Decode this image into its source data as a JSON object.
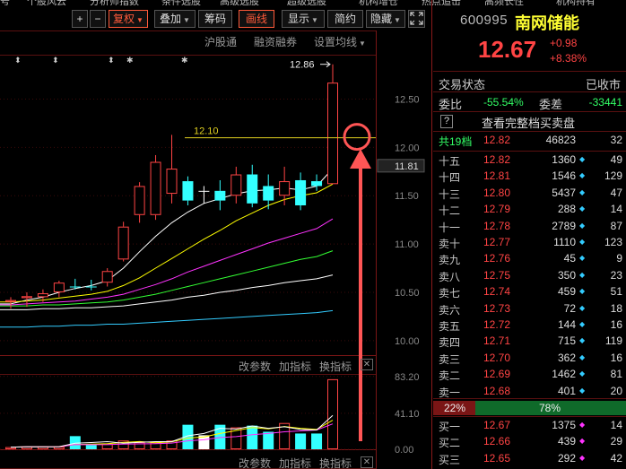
{
  "menu_strip": [
    "号",
    "个股风云",
    "分析师指数",
    "条件选股",
    "高级选股",
    "超级选股",
    "机构增仓",
    "热点追击",
    "高频长性",
    "机构持有"
  ],
  "toolbar": {
    "plus": "+",
    "minus": "−",
    "fq_label": "复权",
    "overlay_label": "叠加",
    "chips_label": "筹码",
    "draw_label": "画线",
    "display_label": "显示",
    "simple_label": "简约",
    "hide_label": "隐藏",
    "expand_icon": "expand-icon"
  },
  "chart_links": {
    "hgt": "沪股通",
    "margin": "融资融券",
    "settings": "设置均线"
  },
  "indicator_bar_1": {
    "params": "改参数",
    "add": "加指标",
    "swap": "换指标",
    "close": "✕"
  },
  "indicator_bar_2": {
    "params": "改参数",
    "add": "加指标",
    "swap": "换指标",
    "close": "✕"
  },
  "annotations": {
    "high_label": "12.86",
    "hline_label": "12.10"
  },
  "chart_data": [
    {
      "type": "candlestick",
      "title": "",
      "y_ticks": [
        "12.50",
        "12.00",
        "11.50",
        "11.00",
        "10.50",
        "10.00"
      ],
      "y_range": [
        9.85,
        12.95
      ],
      "current_price_label": "11.81",
      "candles": [
        {
          "o": 10.4,
          "h": 10.45,
          "l": 10.33,
          "c": 10.42,
          "color": "red"
        },
        {
          "o": 10.44,
          "h": 10.5,
          "l": 10.35,
          "c": 10.46,
          "color": "red"
        },
        {
          "o": 10.45,
          "h": 10.53,
          "l": 10.4,
          "c": 10.49,
          "color": "red"
        },
        {
          "o": 10.5,
          "h": 10.62,
          "l": 10.45,
          "c": 10.6,
          "color": "red"
        },
        {
          "o": 10.56,
          "h": 10.64,
          "l": 10.53,
          "c": 10.56,
          "color": "cyan"
        },
        {
          "o": 10.56,
          "h": 10.63,
          "l": 10.52,
          "c": 10.56,
          "color": "cyan"
        },
        {
          "o": 10.6,
          "h": 10.75,
          "l": 10.56,
          "c": 10.72,
          "color": "red"
        },
        {
          "o": 10.84,
          "h": 11.23,
          "l": 10.82,
          "c": 11.18,
          "color": "red"
        },
        {
          "o": 11.3,
          "h": 11.64,
          "l": 11.22,
          "c": 11.6,
          "color": "red"
        },
        {
          "o": 11.3,
          "h": 11.92,
          "l": 11.25,
          "c": 11.85,
          "color": "red"
        },
        {
          "o": 11.52,
          "h": 12.13,
          "l": 11.42,
          "c": 11.78,
          "color": "red"
        },
        {
          "o": 11.65,
          "h": 11.7,
          "l": 11.4,
          "c": 11.45,
          "color": "cyan"
        },
        {
          "o": 11.55,
          "h": 11.6,
          "l": 11.42,
          "c": 11.55,
          "color": "white"
        },
        {
          "o": 11.55,
          "h": 11.66,
          "l": 11.35,
          "c": 11.45,
          "color": "cyan"
        },
        {
          "o": 11.5,
          "h": 11.8,
          "l": 11.42,
          "c": 11.72,
          "color": "red"
        },
        {
          "o": 11.72,
          "h": 11.82,
          "l": 11.38,
          "c": 11.42,
          "color": "cyan"
        },
        {
          "o": 11.6,
          "h": 11.72,
          "l": 11.36,
          "c": 11.45,
          "color": "cyan"
        },
        {
          "o": 11.5,
          "h": 11.8,
          "l": 11.4,
          "c": 11.65,
          "color": "red"
        },
        {
          "o": 11.66,
          "h": 11.74,
          "l": 11.35,
          "c": 11.4,
          "color": "cyan"
        },
        {
          "o": 11.65,
          "h": 11.72,
          "l": 11.55,
          "c": 11.6,
          "color": "cyan"
        },
        {
          "o": 11.62,
          "h": 12.86,
          "l": 11.62,
          "c": 12.67,
          "color": "red"
        }
      ],
      "ma_lines": [
        {
          "color": "#ffffff",
          "values": [
            10.38,
            10.42,
            10.45,
            10.5,
            10.54,
            10.57,
            10.62,
            10.75,
            10.92,
            11.08,
            11.22,
            11.33,
            11.42,
            11.47,
            11.52,
            11.55,
            11.56,
            11.58,
            11.56,
            11.6,
            11.78
          ]
        },
        {
          "color": "#ffff00",
          "values": [
            10.4,
            10.41,
            10.42,
            10.44,
            10.46,
            10.48,
            10.51,
            10.57,
            10.65,
            10.75,
            10.85,
            10.95,
            11.05,
            11.14,
            11.24,
            11.32,
            11.4,
            11.46,
            11.5,
            11.53,
            11.62
          ]
        },
        {
          "color": "#ff33ff",
          "values": [
            10.37,
            10.38,
            10.39,
            10.4,
            10.41,
            10.43,
            10.45,
            10.48,
            10.53,
            10.58,
            10.64,
            10.71,
            10.77,
            10.83,
            10.89,
            10.95,
            11.01,
            11.06,
            11.11,
            11.16,
            11.26
          ]
        },
        {
          "color": "#33ff33",
          "values": [
            10.36,
            10.36,
            10.37,
            10.37,
            10.38,
            10.39,
            10.4,
            10.42,
            10.45,
            10.48,
            10.52,
            10.56,
            10.6,
            10.64,
            10.68,
            10.72,
            10.76,
            10.8,
            10.84,
            10.87,
            10.93
          ]
        },
        {
          "color": "#ffffff",
          "values": [
            10.32,
            10.32,
            10.33,
            10.33,
            10.34,
            10.34,
            10.35,
            10.36,
            10.38,
            10.4,
            10.42,
            10.45,
            10.47,
            10.5,
            10.52,
            10.55,
            10.57,
            10.6,
            10.62,
            10.64,
            10.68
          ]
        },
        {
          "color": "#33ccff",
          "values": [
            10.14,
            10.14,
            10.15,
            10.15,
            10.16,
            10.16,
            10.17,
            10.17,
            10.18,
            10.19,
            10.2,
            10.21,
            10.22,
            10.23,
            10.24,
            10.25,
            10.26,
            10.27,
            10.28,
            10.29,
            10.31
          ]
        }
      ]
    },
    {
      "type": "bar",
      "title": "",
      "y_ticks": [
        "83.20",
        "41.10",
        "0.00"
      ],
      "y_range": [
        0,
        85
      ],
      "values": [
        2.5,
        3,
        3,
        3,
        15,
        5,
        6,
        10,
        8,
        8,
        10,
        28,
        16,
        28,
        25,
        27,
        20,
        30,
        18,
        18,
        80
      ],
      "colors": [
        "red",
        "red",
        "red",
        "red",
        "cyan",
        "cyan",
        "red",
        "red",
        "red",
        "red",
        "red",
        "cyan",
        "white",
        "cyan",
        "red",
        "cyan",
        "cyan",
        "red",
        "cyan",
        "cyan",
        "red"
      ]
    }
  ],
  "quote": {
    "code": "600995",
    "name": "南网储能",
    "price": "12.67",
    "change": "+0.98",
    "change_pct": "+8.38%",
    "trade_state_label": "交易状态",
    "trade_state_value": "已收市",
    "weibi_label": "委比",
    "weibi_value": "-55.54%",
    "weicha_label": "委差",
    "weicha_value": "-33441",
    "full_book_label": "查看完整档买卖盘",
    "help_icon": "?",
    "total_label": "共19档",
    "total_price": "12.82",
    "total_volume": "46823",
    "total_count": "32"
  },
  "sell_orders": [
    {
      "label": "十五",
      "price": "12.82",
      "volume": "1360",
      "count": "49"
    },
    {
      "label": "十四",
      "price": "12.81",
      "volume": "1546",
      "count": "129"
    },
    {
      "label": "十三",
      "price": "12.80",
      "volume": "5437",
      "count": "47"
    },
    {
      "label": "十二",
      "price": "12.79",
      "volume": "288",
      "count": "14"
    },
    {
      "label": "十一",
      "price": "12.78",
      "volume": "2789",
      "count": "87"
    },
    {
      "label": "卖十",
      "price": "12.77",
      "volume": "1110",
      "count": "123"
    },
    {
      "label": "卖九",
      "price": "12.76",
      "volume": "45",
      "count": "9"
    },
    {
      "label": "卖八",
      "price": "12.75",
      "volume": "350",
      "count": "23"
    },
    {
      "label": "卖七",
      "price": "12.74",
      "volume": "459",
      "count": "51"
    },
    {
      "label": "卖六",
      "price": "12.73",
      "volume": "72",
      "count": "18"
    },
    {
      "label": "卖五",
      "price": "12.72",
      "volume": "144",
      "count": "16"
    },
    {
      "label": "卖四",
      "price": "12.71",
      "volume": "715",
      "count": "119"
    },
    {
      "label": "卖三",
      "price": "12.70",
      "volume": "362",
      "count": "16"
    },
    {
      "label": "卖二",
      "price": "12.69",
      "volume": "1462",
      "count": "81"
    },
    {
      "label": "卖一",
      "price": "12.68",
      "volume": "401",
      "count": "20"
    }
  ],
  "bid_ask_ratio": {
    "buy_pct": "22%",
    "sell_pct": "78%",
    "buy_fraction": 0.22
  },
  "buy_orders": [
    {
      "label": "买一",
      "price": "12.67",
      "volume": "1375",
      "count": "14"
    },
    {
      "label": "买二",
      "price": "12.66",
      "volume": "439",
      "count": "29"
    },
    {
      "label": "买三",
      "price": "12.65",
      "volume": "292",
      "count": "42"
    }
  ],
  "colors": {
    "up": "#ff4444",
    "down": "#33ffff",
    "name": "#ffff33",
    "accent": "#ff5a3a",
    "buy_diamond": "#ff33ff",
    "sell_diamond": "#33ccff"
  }
}
